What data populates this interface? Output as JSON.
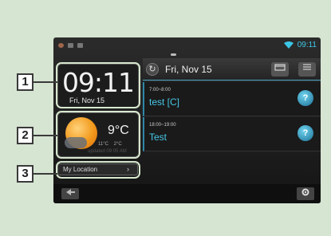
{
  "status_bar": {
    "time": "09:11"
  },
  "clock_widget": {
    "time": "09:11",
    "date": "Fri, Nov 15"
  },
  "weather_widget": {
    "temperature": "9°C",
    "range_high": "11°C",
    "range_low": "2°C",
    "updated": "updated 09:05 AM",
    "icon": "sunny-icon"
  },
  "location_button": {
    "label": "My Location",
    "chevron": "›"
  },
  "calendar": {
    "date": "Fri, Nov 15",
    "refresh_icon": "↻",
    "events": [
      {
        "time": "7:00~8:00",
        "title": "test [C]",
        "icon": "?"
      },
      {
        "time": "18:00~19:00",
        "title": "Test",
        "icon": "?"
      }
    ]
  },
  "callouts": [
    "1",
    "2",
    "3"
  ]
}
